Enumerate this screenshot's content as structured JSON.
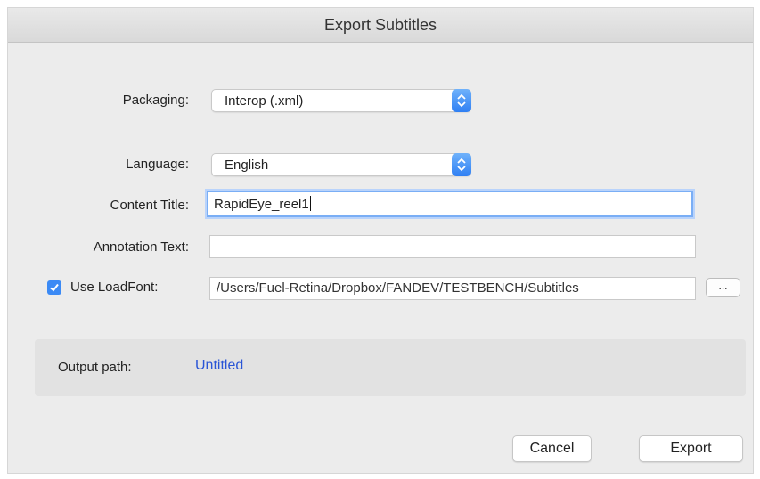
{
  "dialog": {
    "title": "Export Subtitles"
  },
  "form": {
    "packaging": {
      "label": "Packaging:",
      "value": "Interop (.xml)"
    },
    "language": {
      "label": "Language:",
      "value": "English"
    },
    "content_title": {
      "label": "Content Title:",
      "value": "RapidEye_reel1"
    },
    "annotation_text": {
      "label": "Annotation Text:",
      "value": ""
    },
    "load_font": {
      "label": "Use LoadFont:",
      "checked": true,
      "path": "/Users/Fuel-Retina/Dropbox/FANDEV/TESTBENCH/Subtitles",
      "browse_label": "..."
    }
  },
  "output": {
    "label": "Output path:",
    "value": "Untitled",
    "link_color": "#2a55d6"
  },
  "buttons": {
    "cancel": "Cancel",
    "export": "Export"
  },
  "colors": {
    "accent": "#3b8af5"
  }
}
